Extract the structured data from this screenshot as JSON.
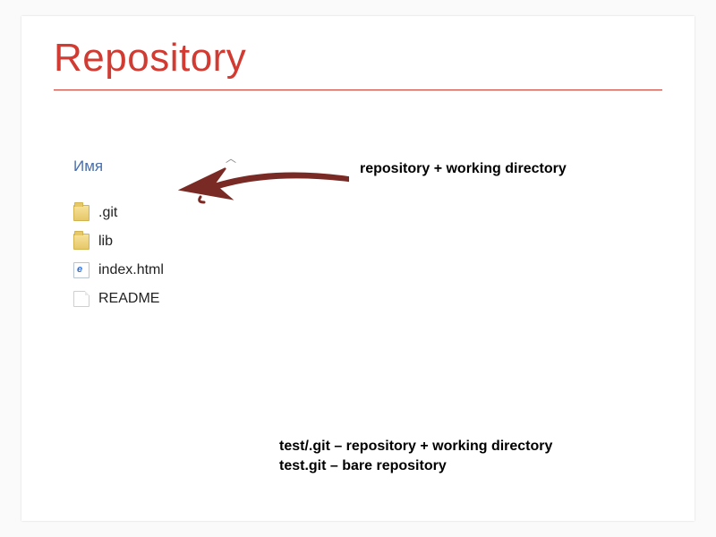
{
  "title": "Repository",
  "explorer": {
    "column_header": "Имя",
    "items": [
      {
        "name": ".git",
        "icon": "folder"
      },
      {
        "name": "lib",
        "icon": "folder"
      },
      {
        "name": "index.html",
        "icon": "html"
      },
      {
        "name": "README",
        "icon": "file"
      }
    ]
  },
  "annotation": "repository + working directory",
  "footer": {
    "line1": "test/.git – repository + working directory",
    "line2": "test.git – bare repository"
  }
}
